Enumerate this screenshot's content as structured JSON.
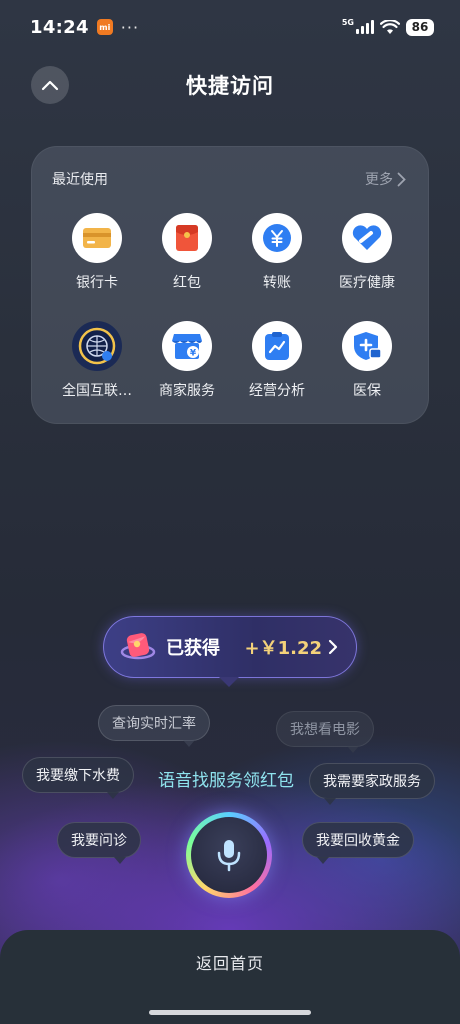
{
  "status_bar": {
    "time": "14:24",
    "carrier_badge": "mi",
    "more_dots": "···",
    "network": "5G",
    "battery": "86"
  },
  "header": {
    "title": "快捷访问",
    "collapse_icon": "chevron-up-icon"
  },
  "recent": {
    "title": "最近使用",
    "more_label": "更多",
    "items": [
      {
        "label": "银行卡",
        "icon": "bank-card-icon",
        "color": "#f2b449"
      },
      {
        "label": "红包",
        "icon": "red-packet-icon",
        "color": "#f0553a"
      },
      {
        "label": "转账",
        "icon": "transfer-icon",
        "color": "#2f7ef2"
      },
      {
        "label": "医疗健康",
        "icon": "health-heart-icon",
        "color": "#2f7ef2"
      },
      {
        "label": "全国互联…",
        "icon": "globe-icon",
        "color": "#2f7ef2"
      },
      {
        "label": "商家服务",
        "icon": "merchant-store-icon",
        "color": "#2f7ef2"
      },
      {
        "label": "经营分析",
        "icon": "business-chart-icon",
        "color": "#2f7ef2"
      },
      {
        "label": "医保",
        "icon": "medical-insurance-icon",
        "color": "#2f7ef2"
      }
    ]
  },
  "reward": {
    "label": "已获得",
    "amount": "+￥1.22"
  },
  "suggestions": {
    "exchange_rate": "查询实时汇率",
    "movie": "我想看电影",
    "water_bill": "我要缴下水费",
    "housekeeping": "我需要家政服务",
    "consult": "我要问诊",
    "gold": "我要回收黄金"
  },
  "voice_hint": "语音找服务领红包",
  "bottom": {
    "home_label": "返回首页"
  }
}
